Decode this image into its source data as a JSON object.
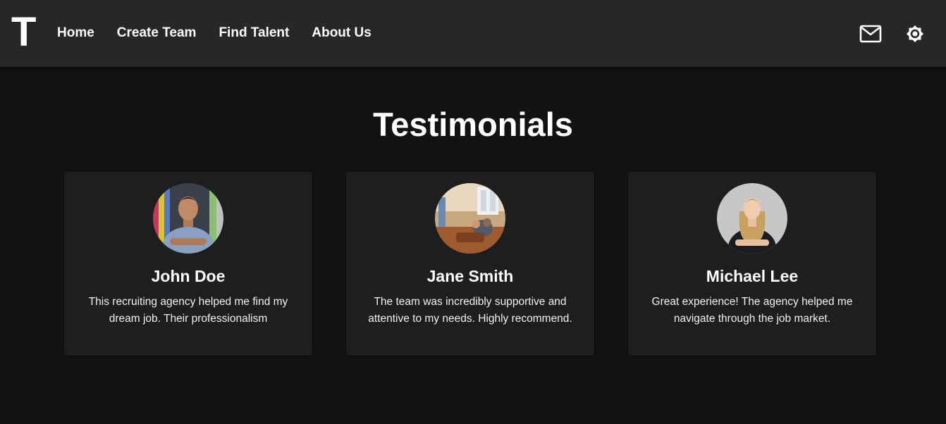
{
  "logo": "T",
  "nav": {
    "home": "Home",
    "create_team": "Create Team",
    "find_talent": "Find Talent",
    "about_us": "About Us"
  },
  "icons": {
    "mail": "mail-icon",
    "theme": "brightness-icon"
  },
  "section_title": "Testimonials",
  "testimonials": [
    {
      "name": "John Doe",
      "quote": "This recruiting agency helped me find my dream job. Their professionalism"
    },
    {
      "name": "Jane Smith",
      "quote": "The team was incredibly supportive and attentive to my needs. Highly recommend."
    },
    {
      "name": "Michael Lee",
      "quote": "Great experience! The agency helped me navigate through the job market."
    }
  ],
  "colors": {
    "background": "#121212",
    "appbar": "#272727",
    "card": "#1e1e1e",
    "text": "#ffffff"
  }
}
